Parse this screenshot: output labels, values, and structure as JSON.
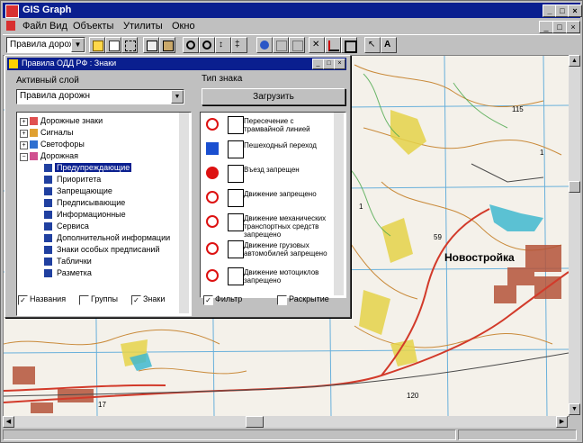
{
  "window": {
    "title": "GIS Graph",
    "controls": [
      "_",
      "□",
      "×"
    ]
  },
  "menu": {
    "items": [
      "Файл",
      "Вид",
      "Объекты",
      "Утилиты",
      "Окно"
    ],
    "mdi_controls": [
      "_",
      "□",
      "×"
    ]
  },
  "toolbar": {
    "combo_value": "Правила дорожн"
  },
  "legend_window": {
    "title": "Правила ОДД РФ : Знаки",
    "active_layer_label": "Активный слой",
    "active_layer_value": "Правила дорожн",
    "sign_type_label": "Тип знака",
    "load_button": "Загрузить",
    "tree": [
      {
        "label": "Дорожные знаки",
        "level": 0,
        "expanded": false
      },
      {
        "label": "Сигналы",
        "level": 0,
        "expanded": false
      },
      {
        "label": "Светофоры",
        "level": 0,
        "expanded": false
      },
      {
        "label": "Дорожная",
        "level": 0,
        "expanded": true
      },
      {
        "label": "Предупреждающие",
        "level": 1,
        "selected": true
      },
      {
        "label": "Приоритета",
        "level": 1
      },
      {
        "label": "Запрещающие",
        "level": 1
      },
      {
        "label": "Предписывающие",
        "level": 1
      },
      {
        "label": "Информационные",
        "level": 1
      },
      {
        "label": "Сервиса",
        "level": 1
      },
      {
        "label": "Дополнительной информации",
        "level": 1
      },
      {
        "label": "Знаки особых предписаний",
        "level": 1
      },
      {
        "label": "Таблички",
        "level": 1
      },
      {
        "label": "Разметка",
        "level": 1
      }
    ],
    "signs": [
      {
        "text": "Пересечение с трамвайной линией",
        "sym": "red-circle-icon"
      },
      {
        "text": "Пешеходный переход",
        "sym": "blue-square-icon"
      },
      {
        "text": "Въезд запрещен",
        "sym": "no-entry-icon"
      },
      {
        "text": "Движение запрещено",
        "sym": "red-ring-icon"
      },
      {
        "text": "Движение механических транспортных средств запрещено",
        "sym": "no-vehicles-icon"
      },
      {
        "text": "Движение грузовых автомобилей запрещено",
        "sym": "no-trucks-icon"
      },
      {
        "text": "Движение мотоциклов запрещено",
        "sym": "no-moto-icon"
      }
    ],
    "left_checks": [
      {
        "label": "Названия",
        "checked": true
      },
      {
        "label": "Группы",
        "checked": false
      },
      {
        "label": "Знаки",
        "checked": true
      }
    ],
    "right_checks": [
      {
        "label": "Фильтр",
        "checked": true
      },
      {
        "label": "Раскрытие",
        "checked": false
      }
    ]
  },
  "map": {
    "town_label": "Новостройка",
    "numbers": [
      "59",
      "115",
      "120",
      "1",
      "1",
      "17"
    ]
  }
}
